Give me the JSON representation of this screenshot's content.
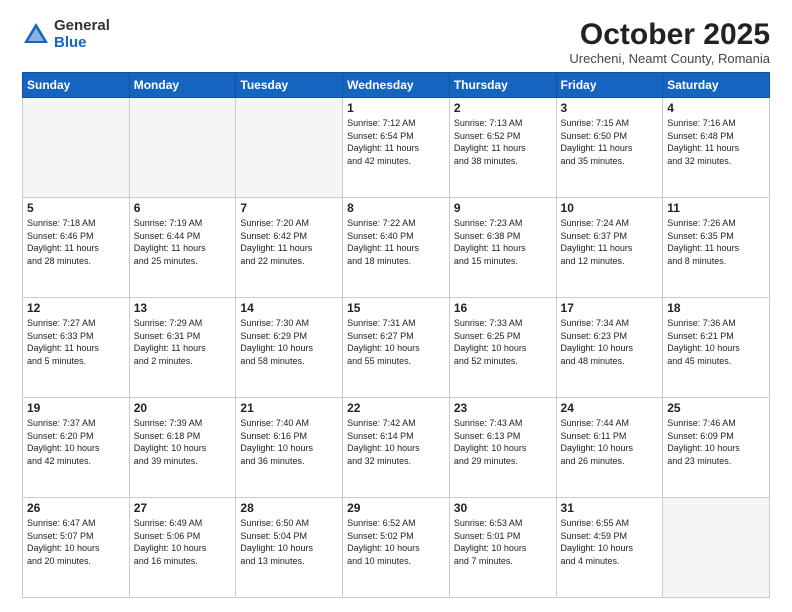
{
  "logo": {
    "general": "General",
    "blue": "Blue"
  },
  "title": "October 2025",
  "location": "Urecheni, Neamt County, Romania",
  "headers": [
    "Sunday",
    "Monday",
    "Tuesday",
    "Wednesday",
    "Thursday",
    "Friday",
    "Saturday"
  ],
  "weeks": [
    [
      {
        "day": "",
        "info": ""
      },
      {
        "day": "",
        "info": ""
      },
      {
        "day": "",
        "info": ""
      },
      {
        "day": "1",
        "info": "Sunrise: 7:12 AM\nSunset: 6:54 PM\nDaylight: 11 hours\nand 42 minutes."
      },
      {
        "day": "2",
        "info": "Sunrise: 7:13 AM\nSunset: 6:52 PM\nDaylight: 11 hours\nand 38 minutes."
      },
      {
        "day": "3",
        "info": "Sunrise: 7:15 AM\nSunset: 6:50 PM\nDaylight: 11 hours\nand 35 minutes."
      },
      {
        "day": "4",
        "info": "Sunrise: 7:16 AM\nSunset: 6:48 PM\nDaylight: 11 hours\nand 32 minutes."
      }
    ],
    [
      {
        "day": "5",
        "info": "Sunrise: 7:18 AM\nSunset: 6:46 PM\nDaylight: 11 hours\nand 28 minutes."
      },
      {
        "day": "6",
        "info": "Sunrise: 7:19 AM\nSunset: 6:44 PM\nDaylight: 11 hours\nand 25 minutes."
      },
      {
        "day": "7",
        "info": "Sunrise: 7:20 AM\nSunset: 6:42 PM\nDaylight: 11 hours\nand 22 minutes."
      },
      {
        "day": "8",
        "info": "Sunrise: 7:22 AM\nSunset: 6:40 PM\nDaylight: 11 hours\nand 18 minutes."
      },
      {
        "day": "9",
        "info": "Sunrise: 7:23 AM\nSunset: 6:38 PM\nDaylight: 11 hours\nand 15 minutes."
      },
      {
        "day": "10",
        "info": "Sunrise: 7:24 AM\nSunset: 6:37 PM\nDaylight: 11 hours\nand 12 minutes."
      },
      {
        "day": "11",
        "info": "Sunrise: 7:26 AM\nSunset: 6:35 PM\nDaylight: 11 hours\nand 8 minutes."
      }
    ],
    [
      {
        "day": "12",
        "info": "Sunrise: 7:27 AM\nSunset: 6:33 PM\nDaylight: 11 hours\nand 5 minutes."
      },
      {
        "day": "13",
        "info": "Sunrise: 7:29 AM\nSunset: 6:31 PM\nDaylight: 11 hours\nand 2 minutes."
      },
      {
        "day": "14",
        "info": "Sunrise: 7:30 AM\nSunset: 6:29 PM\nDaylight: 10 hours\nand 58 minutes."
      },
      {
        "day": "15",
        "info": "Sunrise: 7:31 AM\nSunset: 6:27 PM\nDaylight: 10 hours\nand 55 minutes."
      },
      {
        "day": "16",
        "info": "Sunrise: 7:33 AM\nSunset: 6:25 PM\nDaylight: 10 hours\nand 52 minutes."
      },
      {
        "day": "17",
        "info": "Sunrise: 7:34 AM\nSunset: 6:23 PM\nDaylight: 10 hours\nand 48 minutes."
      },
      {
        "day": "18",
        "info": "Sunrise: 7:36 AM\nSunset: 6:21 PM\nDaylight: 10 hours\nand 45 minutes."
      }
    ],
    [
      {
        "day": "19",
        "info": "Sunrise: 7:37 AM\nSunset: 6:20 PM\nDaylight: 10 hours\nand 42 minutes."
      },
      {
        "day": "20",
        "info": "Sunrise: 7:39 AM\nSunset: 6:18 PM\nDaylight: 10 hours\nand 39 minutes."
      },
      {
        "day": "21",
        "info": "Sunrise: 7:40 AM\nSunset: 6:16 PM\nDaylight: 10 hours\nand 36 minutes."
      },
      {
        "day": "22",
        "info": "Sunrise: 7:42 AM\nSunset: 6:14 PM\nDaylight: 10 hours\nand 32 minutes."
      },
      {
        "day": "23",
        "info": "Sunrise: 7:43 AM\nSunset: 6:13 PM\nDaylight: 10 hours\nand 29 minutes."
      },
      {
        "day": "24",
        "info": "Sunrise: 7:44 AM\nSunset: 6:11 PM\nDaylight: 10 hours\nand 26 minutes."
      },
      {
        "day": "25",
        "info": "Sunrise: 7:46 AM\nSunset: 6:09 PM\nDaylight: 10 hours\nand 23 minutes."
      }
    ],
    [
      {
        "day": "26",
        "info": "Sunrise: 6:47 AM\nSunset: 5:07 PM\nDaylight: 10 hours\nand 20 minutes."
      },
      {
        "day": "27",
        "info": "Sunrise: 6:49 AM\nSunset: 5:06 PM\nDaylight: 10 hours\nand 16 minutes."
      },
      {
        "day": "28",
        "info": "Sunrise: 6:50 AM\nSunset: 5:04 PM\nDaylight: 10 hours\nand 13 minutes."
      },
      {
        "day": "29",
        "info": "Sunrise: 6:52 AM\nSunset: 5:02 PM\nDaylight: 10 hours\nand 10 minutes."
      },
      {
        "day": "30",
        "info": "Sunrise: 6:53 AM\nSunset: 5:01 PM\nDaylight: 10 hours\nand 7 minutes."
      },
      {
        "day": "31",
        "info": "Sunrise: 6:55 AM\nSunset: 4:59 PM\nDaylight: 10 hours\nand 4 minutes."
      },
      {
        "day": "",
        "info": ""
      }
    ]
  ]
}
